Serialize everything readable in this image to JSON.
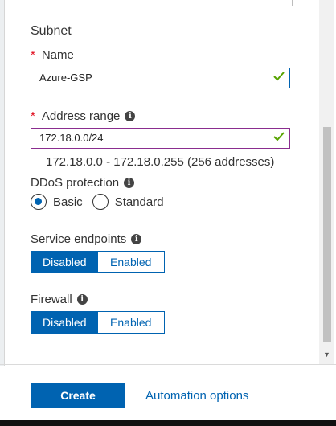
{
  "subnet": {
    "title": "Subnet",
    "name_label": "Name",
    "name_value": "Azure-GSP",
    "address_label": "Address range",
    "address_value": "172.18.0.0/24",
    "address_info": "172.18.0.0 - 172.18.0.255 (256 addresses)",
    "required_mark": "*"
  },
  "ddos": {
    "label": "DDoS protection",
    "options": [
      "Basic",
      "Standard"
    ],
    "selected": "Basic"
  },
  "service_endpoints": {
    "label": "Service endpoints",
    "options": [
      "Disabled",
      "Enabled"
    ],
    "selected": "Disabled"
  },
  "firewall": {
    "label": "Firewall",
    "options": [
      "Disabled",
      "Enabled"
    ],
    "selected": "Disabled"
  },
  "footer": {
    "create_label": "Create",
    "automation_label": "Automation options"
  },
  "icons": {
    "info": "info-icon",
    "valid": "check-icon",
    "scroll_down": "chevron-down-icon"
  },
  "colors": {
    "accent": "#0063b1",
    "name_border": "#0063b1",
    "address_border": "#8a2d8f",
    "valid_check": "#57a300",
    "required": "#e00b1c"
  }
}
